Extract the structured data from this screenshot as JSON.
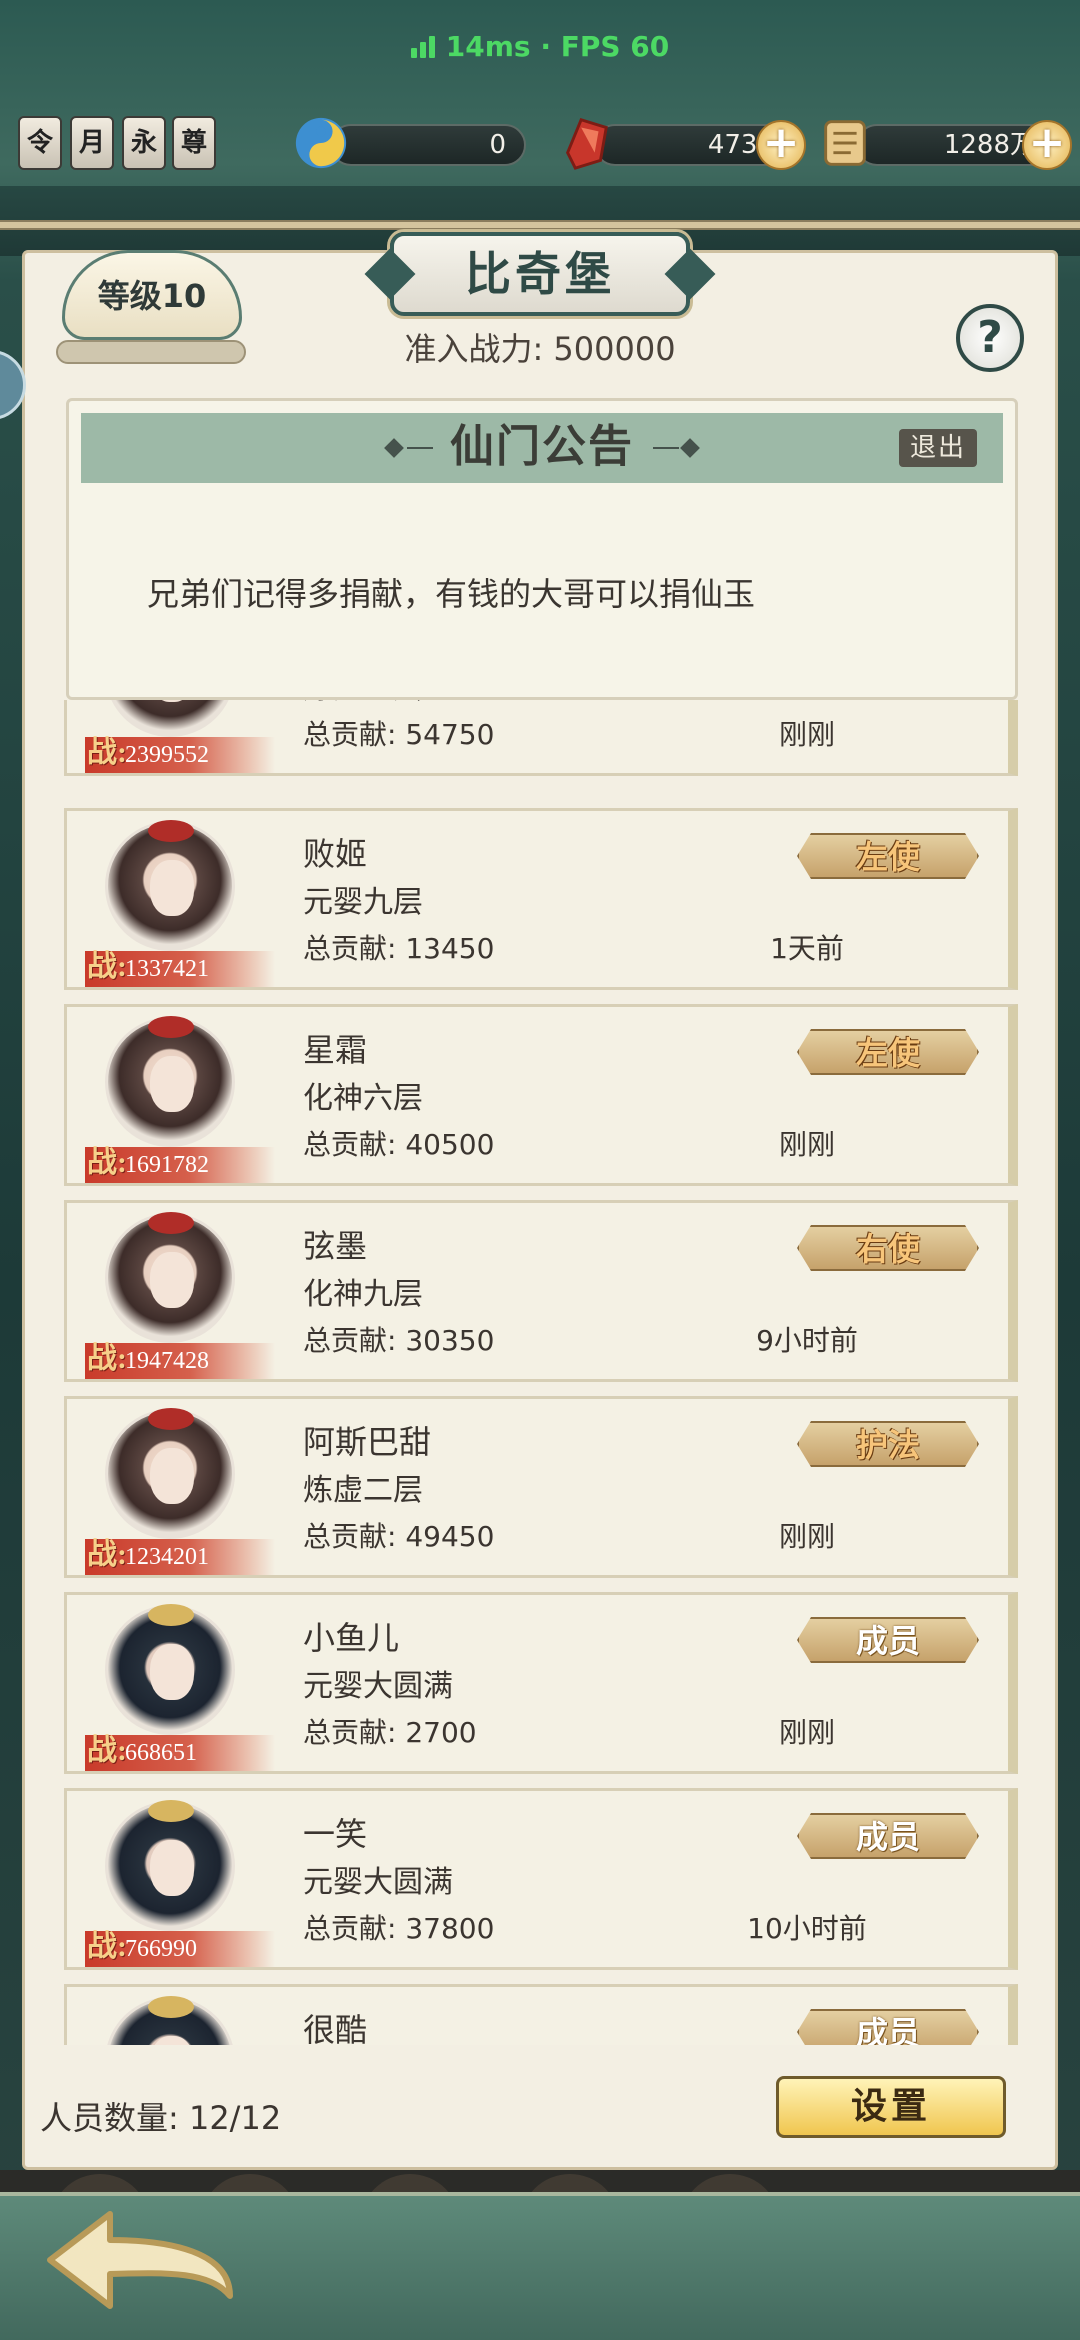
{
  "status": {
    "ping": "14ms · FPS 60"
  },
  "badges": [
    "令",
    "月",
    "永",
    "尊"
  ],
  "resources": [
    {
      "icon": "swirl-orb-icon",
      "value": "0"
    },
    {
      "icon": "red-jade-icon",
      "value": "4733"
    },
    {
      "icon": "scroll-coin-icon",
      "value": "1288万"
    }
  ],
  "header": {
    "title": "比奇堡",
    "level": "等级10",
    "power_label": "准入战力: 500000",
    "help": "?"
  },
  "announcement": {
    "title": "仙门公告",
    "exit": "退出",
    "text": "兄弟们记得多捐献，有钱的大哥可以捐仙玉"
  },
  "members": [
    {
      "name": "",
      "realm": "炼虚五层",
      "contribution": "总贡献: 54750",
      "time": "刚刚",
      "combat": "2399552",
      "rank": "",
      "avatar": "female"
    },
    {
      "name": "败姬",
      "realm": "元婴九层",
      "contribution": "总贡献: 13450",
      "time": "1天前",
      "combat": "1337421",
      "rank": "左使",
      "avatar": "female"
    },
    {
      "name": "星霜",
      "realm": "化神六层",
      "contribution": "总贡献: 40500",
      "time": "刚刚",
      "combat": "1691782",
      "rank": "左使",
      "avatar": "female"
    },
    {
      "name": "弦墨",
      "realm": "化神九层",
      "contribution": "总贡献: 30350",
      "time": "9小时前",
      "combat": "1947428",
      "rank": "右使",
      "avatar": "female"
    },
    {
      "name": "阿斯巴甜",
      "realm": "炼虚二层",
      "contribution": "总贡献: 49450",
      "time": "刚刚",
      "combat": "1234201",
      "rank": "护法",
      "avatar": "female"
    },
    {
      "name": "小鱼儿",
      "realm": "元婴大圆满",
      "contribution": "总贡献: 2700",
      "time": "刚刚",
      "combat": "668651",
      "rank": "成员",
      "avatar": "male"
    },
    {
      "name": "一笑",
      "realm": "元婴大圆满",
      "contribution": "总贡献: 37800",
      "time": "10小时前",
      "combat": "766990",
      "rank": "成员",
      "avatar": "male"
    },
    {
      "name": "很酷",
      "realm": "",
      "contribution": "",
      "time": "",
      "combat": "",
      "rank": "成员",
      "avatar": "male"
    }
  ],
  "combat_prefix": "战:",
  "footer": {
    "member_count": "人员数量: 12/12",
    "settings": "设置"
  },
  "colors": {
    "accent_green": "#4cd964",
    "panel_bg": "#f3efe3",
    "rank_gold": "#c6a26b"
  }
}
